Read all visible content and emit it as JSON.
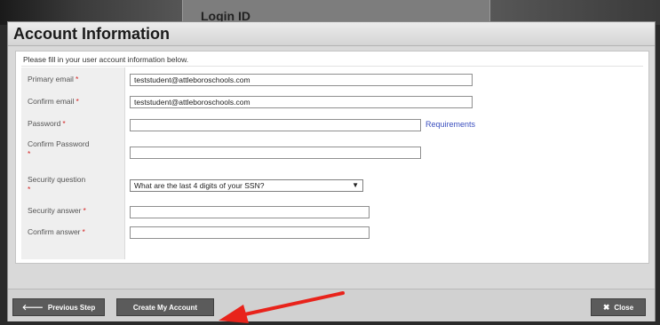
{
  "background": {
    "login_label": "Login ID"
  },
  "dialog": {
    "title": "Account Information",
    "intro": "Please fill in your user account information below."
  },
  "form": {
    "required_mark": "*",
    "primary_email": {
      "label": "Primary email",
      "value": "teststudent@attleboroschools.com"
    },
    "confirm_email": {
      "label": "Confirm email",
      "value": "teststudent@attleboroschools.com"
    },
    "password": {
      "label": "Password",
      "value": ""
    },
    "requirements_link": "Requirements",
    "confirm_password": {
      "label": "Confirm Password",
      "value": ""
    },
    "security_question": {
      "label": "Security question",
      "selected": "What are the last 4 digits of your SSN?"
    },
    "security_answer": {
      "label": "Security answer",
      "value": ""
    },
    "confirm_answer": {
      "label": "Confirm answer",
      "value": ""
    }
  },
  "footer": {
    "previous_label": "Previous Step",
    "create_label": "Create My Account",
    "close_label": "Close"
  },
  "colors": {
    "required": "#d42424",
    "link": "#3b4fbf",
    "annotation_arrow": "#e8231b"
  },
  "icons": {
    "previous": "arrow-left-icon",
    "close": "x-icon",
    "select": "chevron-down-icon"
  }
}
